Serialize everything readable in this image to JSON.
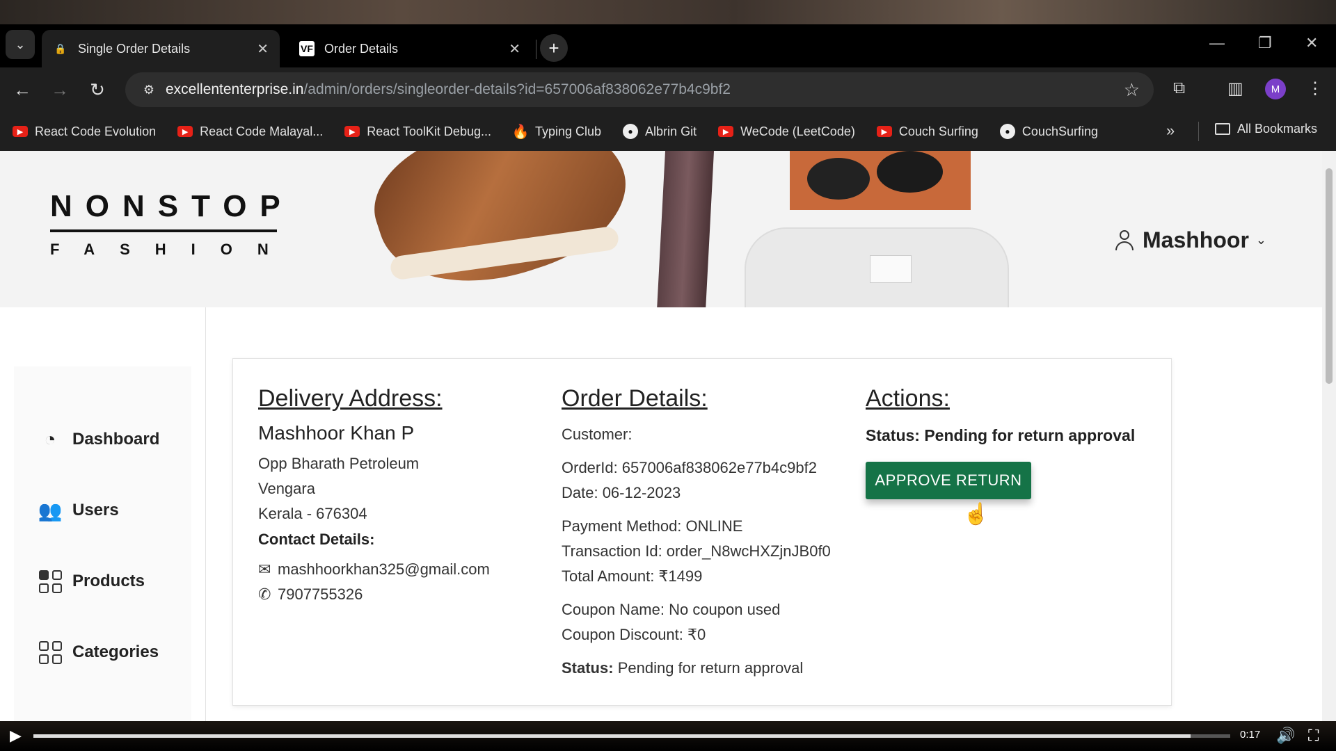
{
  "browser": {
    "tabs": [
      {
        "title": "Single Order Details",
        "active": true
      },
      {
        "title": "Order Details",
        "active": false
      }
    ],
    "url_host": "excellententerprise.in",
    "url_path": "/admin/orders/singleorder-details?id=657006af838062e77b4c9bf2",
    "profile_initial": "M",
    "bookmarks": [
      {
        "label": "React Code Evolution",
        "icon": "youtube-icon"
      },
      {
        "label": "React Code Malayal...",
        "icon": "youtube-icon"
      },
      {
        "label": "React ToolKit Debug...",
        "icon": "youtube-icon"
      },
      {
        "label": "Typing Club",
        "icon": "fire-icon"
      },
      {
        "label": "Albrin Git",
        "icon": "github-icon"
      },
      {
        "label": "WeCode (LeetCode)",
        "icon": "youtube-icon"
      },
      {
        "label": "Couch Surfing",
        "icon": "youtube-icon"
      },
      {
        "label": "CouchSurfing",
        "icon": "github-icon"
      }
    ],
    "all_bookmarks": "All Bookmarks"
  },
  "header": {
    "logo_top": "NONSTOP",
    "logo_bottom": "FASHION",
    "user_name": "Mashhoor"
  },
  "sidebar": {
    "items": [
      {
        "label": "Dashboard",
        "icon": "dashboard-gauge-icon"
      },
      {
        "label": "Users",
        "icon": "users-icon"
      },
      {
        "label": "Products",
        "icon": "products-grid-icon"
      },
      {
        "label": "Categories",
        "icon": "categories-grid-icon"
      }
    ]
  },
  "delivery": {
    "heading": "Delivery Address:",
    "name": "Mashhoor Khan P",
    "line1": "Opp Bharath Petroleum",
    "line2": "Vengara",
    "line3": "Kerala - 676304",
    "contact_label": "Contact Details:",
    "email": "mashhoorkhan325@gmail.com",
    "phone": "7907755326"
  },
  "order": {
    "heading": "Order Details:",
    "customer": "Customer:",
    "order_id": "OrderId: 657006af838062e77b4c9bf2",
    "date": "Date: 06-12-2023",
    "payment_method": "Payment Method: ONLINE",
    "transaction_id": "Transaction Id: order_N8wcHXZjnJB0f0",
    "total_amount": "Total Amount: ₹1499",
    "coupon_name": "Coupon Name: No coupon used",
    "coupon_discount": "Coupon Discount: ₹0",
    "status_label": "Status:",
    "status_value": "Pending for return approval"
  },
  "actions": {
    "heading": "Actions:",
    "status": "Status: Pending for return approval",
    "approve_button": "APPROVE RETURN"
  },
  "video": {
    "time": "0:17",
    "progress": 0.967
  }
}
